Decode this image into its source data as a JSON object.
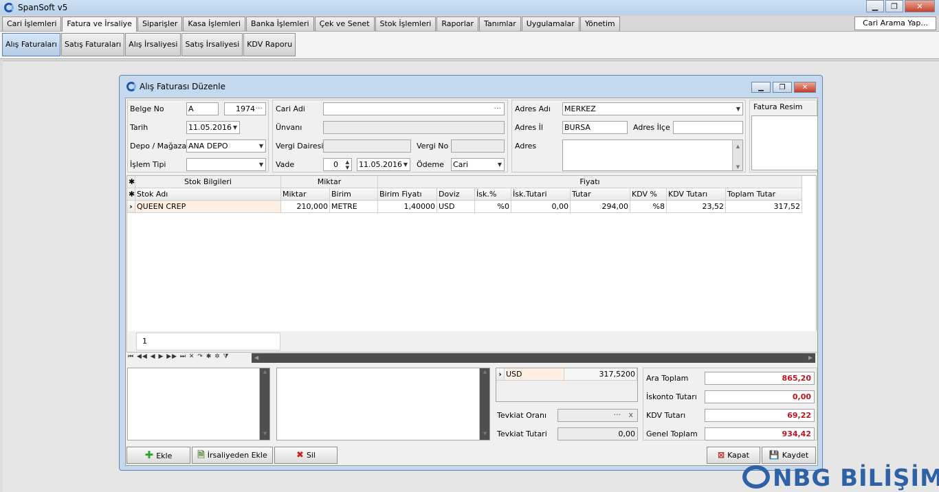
{
  "app": {
    "title": "SpanSoft v5"
  },
  "window_buttons": {
    "minimize": "▁",
    "restore": "❐",
    "close": "✕"
  },
  "menu": {
    "tabs": [
      "Cari İşlemleri",
      "Fatura ve İrsaliye",
      "Siparişler",
      "Kasa İşlemleri",
      "Banka İşlemleri",
      "Çek ve Senet",
      "Stok İşlemleri",
      "Raporlar",
      "Tanımlar",
      "Uygulamalar",
      "Yönetim"
    ],
    "search_label": "Cari Arama Yap..."
  },
  "subtabs": [
    "Alış Faturaları",
    "Satış Faturaları",
    "Alış İrsaliyesi",
    "Satış İrsaliyesi",
    "KDV Raporu"
  ],
  "dialog": {
    "title": "Alış Faturası Düzenle",
    "form": {
      "belge_no_label": "Belge No",
      "belge_no_series": "A",
      "belge_no_number": "1974",
      "tarih_label": "Tarih",
      "tarih_value": "11.05.2016",
      "depo_label": "Depo / Mağaza",
      "depo_value": "ANA DEPO",
      "islem_tipi_label": "İşlem Tipi",
      "islem_tipi_value": "",
      "cari_adi_label": "Cari Adi",
      "unvani_label": "Ünvanı",
      "vergi_dairesi_label": "Vergi Dairesi",
      "vergi_no_label": "Vergi No",
      "vade_label": "Vade",
      "vade_days": "0",
      "vade_date": "11.05.2016",
      "odeme_label": "Ödeme",
      "odeme_value": "Cari",
      "adres_adi_label": "Adres Adı",
      "adres_adi_value": "MERKEZ",
      "adres_il_label": "Adres İl",
      "adres_il_value": "BURSA",
      "adres_ilce_label": "Adres İlçe",
      "adres_label": "Adres",
      "fatura_resim_label": "Fatura Resim"
    },
    "grid": {
      "bands": {
        "stok": "Stok Bilgileri",
        "miktar": "Miktar",
        "fiyati": "Fiyatı"
      },
      "columns": [
        "Stok Adı",
        "Miktar",
        "Birim",
        "Birim Fiyatı",
        "Doviz",
        "İsk.%",
        "İsk.Tutari",
        "Tutar",
        "KDV %",
        "KDV Tutarı",
        "Toplam Tutar"
      ],
      "rows": [
        {
          "stok_adi": "QUEEN CREP",
          "miktar": "210,000",
          "birim": "METRE",
          "birim_fiyati": "1,40000",
          "doviz": "USD",
          "isk_yuzde": "%0",
          "isk_tutari": "0,00",
          "tutar": "294,00",
          "kdv_yuzde": "%8",
          "kdv_tutari": "23,52",
          "toplam_tutar": "317,52"
        }
      ],
      "footer_count": "1"
    },
    "currency_summary": {
      "currency": "USD",
      "amount": "317,5200"
    },
    "tevkiat": {
      "orani_label": "Tevkiat Oranı",
      "tutari_label": "Tevkiat Tutari",
      "tutari_value": "0,00"
    },
    "totals": {
      "ara_toplam_label": "Ara Toplam",
      "ara_toplam": "865,20",
      "iskonto_label": "İskonto Tutarı",
      "iskonto": "0,00",
      "kdv_label": "KDV Tutarı",
      "kdv": "69,22",
      "genel_label": "Genel Toplam",
      "genel": "934,42"
    },
    "buttons": {
      "ekle": "Ekle",
      "irsaliyeden_ekle": "İrsaliyeden Ekle",
      "sil": "Sil",
      "kapat": "Kapat",
      "kaydet": "Kaydet"
    }
  },
  "watermark": "NBG BİLİŞİM",
  "colors": {
    "title_bar": "#b9d1ea",
    "total_text": "#c0141f",
    "dialog_frame": "#c5d9ee"
  }
}
